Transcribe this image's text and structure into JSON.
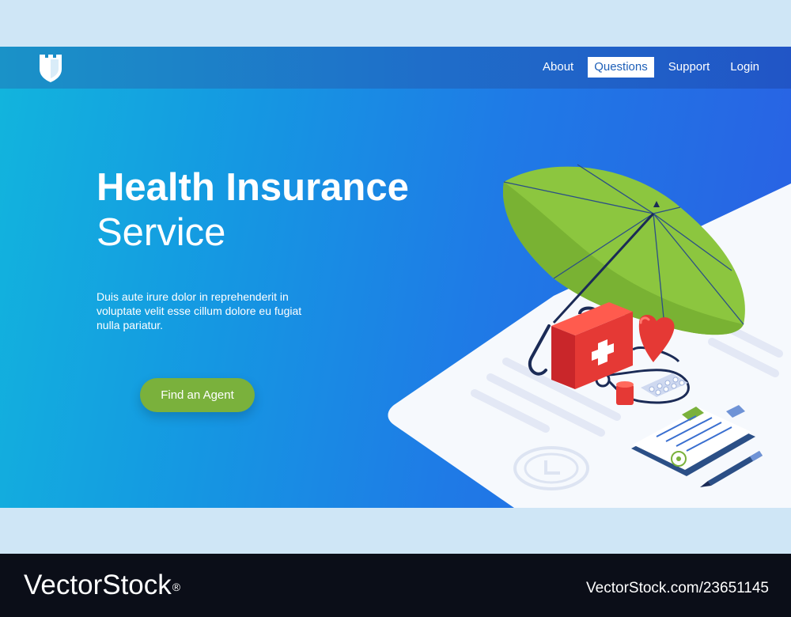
{
  "nav": {
    "items": [
      {
        "label": "About",
        "active": false
      },
      {
        "label": "Questions",
        "active": true
      },
      {
        "label": "Support",
        "active": false
      },
      {
        "label": "Login",
        "active": false
      }
    ]
  },
  "hero": {
    "title": "Health Insurance",
    "subtitle": "Service",
    "description": "Duis aute irure dolor in reprehenderit in voluptate velit esse  cillum dolore eu fugiat nulla pariatur.",
    "cta_label": "Find an Agent"
  },
  "watermark": {
    "brand": "VectorStock",
    "registered": "®",
    "id": "VectorStock.com/23651145"
  },
  "colors": {
    "nav_active_bg": "#ffffff",
    "cta": "#7ab13c",
    "umbrella": "#8cc63f",
    "first_aid": "#e53935",
    "heart": "#e53935",
    "footer": "#0b0e18",
    "band": "#cfe6f6"
  },
  "icons": [
    "shield-logo-icon",
    "umbrella-icon",
    "first-aid-kit-icon",
    "heart-icon",
    "stethoscope-icon",
    "pill-blister-icon",
    "pill-bottle-icon",
    "clipboard-icon",
    "pen-icon",
    "stamp-icon"
  ]
}
